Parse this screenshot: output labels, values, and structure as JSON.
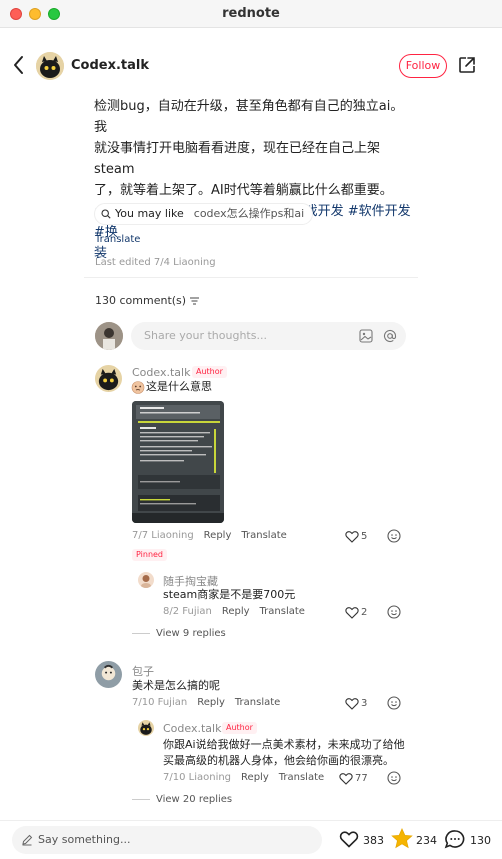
{
  "window": {
    "title": "rednote"
  },
  "header": {
    "author_name": "Codex.talk",
    "follow_label": "Follow"
  },
  "post": {
    "lines": [
      "检测bug，自动在升级，甚至角色都有自己的独立ai。我",
      "就没事情打开电脑看看进度，现在已经在自己上架steam",
      "了，就等着上架了。AI时代等着躺赢比什么都重要。"
    ],
    "hashtags_line1": "#howto入门codex #游戏开发 #游戏开发 #软件开发 #换",
    "hashtags_line2": "装",
    "you_may_like_label": "You may like",
    "you_may_like_query": "codex怎么操作ps和ai",
    "translate_label": "Translate",
    "last_edited": "Last edited 7/4 Liaoning"
  },
  "comments": {
    "count_label": "130 comment(s)",
    "input_placeholder": "Share your thoughts...",
    "items": [
      {
        "name": "Codex.talk",
        "tag": "Author",
        "text": "这是什么意思",
        "date": "7/7 Liaoning",
        "reply": "Reply",
        "translate": "Translate",
        "likes": "5",
        "pinned": "Pinned"
      },
      {
        "name": "随手掏宝藏",
        "text": "steam商家是不是要700元",
        "date": "8/2 Fujian",
        "reply": "Reply",
        "translate": "Translate",
        "likes": "2",
        "view_replies": "View 9 replies"
      },
      {
        "name": "包子",
        "text": "美术是怎么搞的呢",
        "date": "7/10 Fujian",
        "reply": "Reply",
        "translate": "Translate",
        "likes": "3"
      },
      {
        "name": "Codex.talk",
        "tag": "Author",
        "text_line1": "你跟Ai说给我做好一点美术素材，未来成功了给他",
        "text_line2": "买最高级的机器人身体，他会给你画的很漂亮。",
        "date": "7/10 Liaoning",
        "reply": "Reply",
        "translate": "Translate",
        "likes": "77",
        "view_replies": "View 20 replies"
      }
    ]
  },
  "bottom_bar": {
    "input_placeholder": "Say something...",
    "likes": "383",
    "stars": "234",
    "comments": "130"
  },
  "colors": {
    "accent": "#ff2442",
    "link": "#13386c",
    "star": "#f5b400"
  }
}
